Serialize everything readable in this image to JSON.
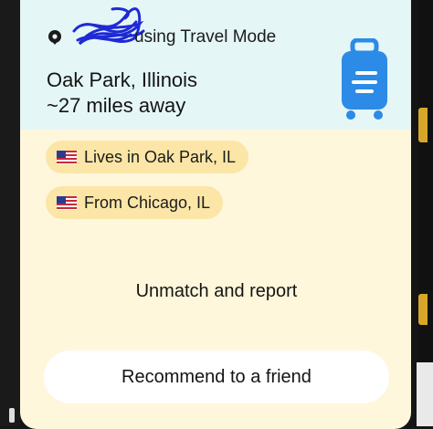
{
  "travel": {
    "status_text": "using Travel Mode",
    "city": "Oak Park, Illinois",
    "distance": "~27 miles away",
    "pin_icon": "location-pin-icon",
    "luggage_icon": "suitcase-icon",
    "accent_color": "#2b8be6"
  },
  "chips": [
    {
      "label": "Lives in Oak Park, IL",
      "icon": "us-flag-icon"
    },
    {
      "label": "From Chicago, IL",
      "icon": "us-flag-icon"
    }
  ],
  "actions": {
    "unmatch_label": "Unmatch and report",
    "recommend_label": "Recommend to a friend"
  }
}
